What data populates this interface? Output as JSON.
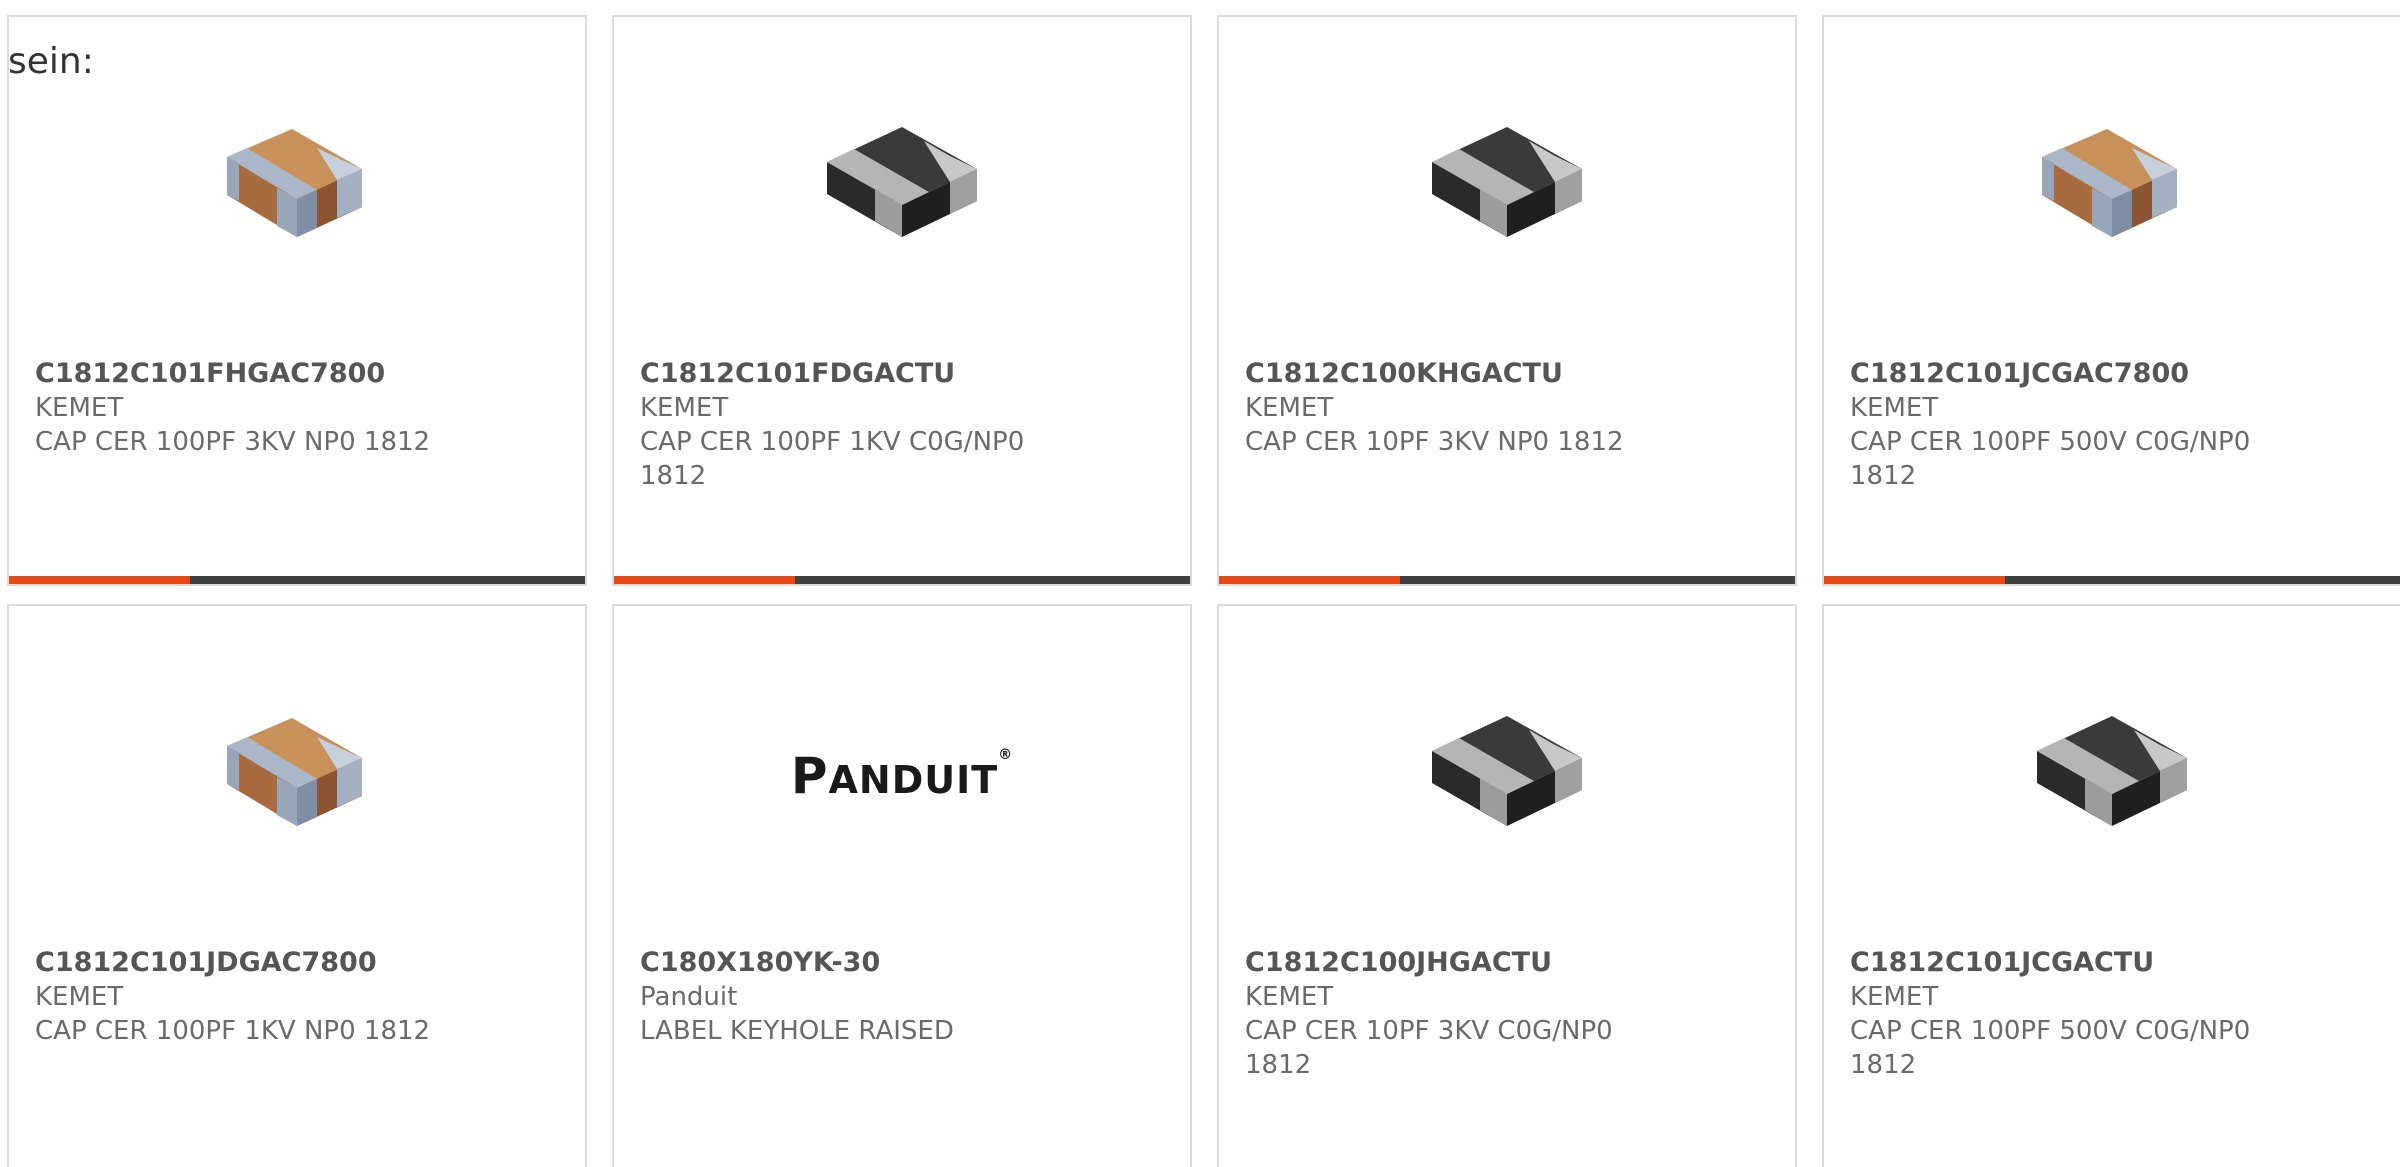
{
  "intro_text": "sein:",
  "colors": {
    "accent": "#e84a16",
    "bar_dark": "#404040",
    "card_border": "#dcdcdc",
    "text_bold": "#555555",
    "text_regular": "#6a6a6a"
  },
  "products": [
    {
      "part_number": "C1812C101FHGAC7800",
      "manufacturer": "KEMET",
      "description": "CAP CER 100PF 3KV NP0 1812",
      "image": "chip-capacitor-brown-icon"
    },
    {
      "part_number": "C1812C101FDGACTU",
      "manufacturer": "KEMET",
      "description": "CAP CER 100PF 1KV C0G/NP0 1812",
      "image": "chip-capacitor-black-icon"
    },
    {
      "part_number": "C1812C100KHGACTU",
      "manufacturer": "KEMET",
      "description": "CAP CER 10PF 3KV NP0 1812",
      "image": "chip-capacitor-black-icon"
    },
    {
      "part_number": "C1812C101JCGAC7800",
      "manufacturer": "KEMET",
      "description": "CAP CER 100PF 500V C0G/NP0 1812",
      "image": "chip-capacitor-brown-icon"
    },
    {
      "part_number": "C1812C101JDGAC7800",
      "manufacturer": "KEMET",
      "description": "CAP CER 100PF 1KV NP0 1812",
      "image": "chip-capacitor-brown-icon"
    },
    {
      "part_number": "C180X180YK-30",
      "manufacturer": "Panduit",
      "description": "LABEL KEYHOLE RAISED",
      "image": "panduit-logo",
      "logo_text": {
        "first": "P",
        "rest": "ANDUIT",
        "mark": "®"
      }
    },
    {
      "part_number": "C1812C100JHGACTU",
      "manufacturer": "KEMET",
      "description": "CAP CER 10PF 3KV C0G/NP0 1812",
      "image": "chip-capacitor-black-icon"
    },
    {
      "part_number": "C1812C101JCGACTU",
      "manufacturer": "KEMET",
      "description": "CAP CER 100PF 500V C0G/NP0 1812",
      "image": "chip-capacitor-black-icon"
    }
  ]
}
